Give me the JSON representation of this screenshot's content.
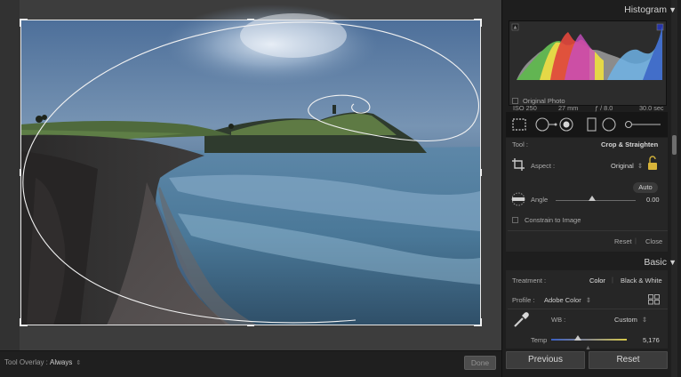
{
  "toolbar": {
    "overlay_label": "Tool Overlay :",
    "overlay_value": "Always",
    "done_label": "Done"
  },
  "histogram": {
    "title": "Histogram",
    "iso": "ISO 250",
    "focal": "27 mm",
    "aperture": "ƒ / 8.0",
    "shutter": "30.0 sec",
    "original_photo_label": "Original Photo"
  },
  "crop": {
    "tool_label": "Tool :",
    "tool_value": "Crop & Straighten",
    "aspect_label": "Aspect :",
    "aspect_value": "Original",
    "auto_label": "Auto",
    "angle_label": "Angle",
    "angle_value": "0.00",
    "constrain_label": "Constrain to Image",
    "reset_label": "Reset",
    "close_label": "Close"
  },
  "basic": {
    "title": "Basic",
    "treatment_label": "Treatment :",
    "treatment_color": "Color",
    "treatment_bw": "Black & White",
    "profile_label": "Profile :",
    "profile_value": "Adobe Color",
    "wb_label": "WB :",
    "wb_value": "Custom",
    "temp_label": "Temp",
    "temp_value": "5,176"
  },
  "footer": {
    "previous_label": "Previous",
    "reset_label": "Reset"
  },
  "icons": [
    "crop-overlay-icon",
    "spot-removal-icon",
    "red-eye-icon",
    "graduated-filter-icon",
    "radial-filter-icon",
    "adjustment-brush-icon",
    "lock-icon",
    "level-icon",
    "eyedropper-icon",
    "grid-icon"
  ]
}
